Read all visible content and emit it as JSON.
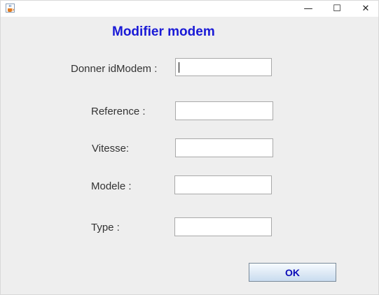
{
  "window": {
    "minimize_glyph": "—",
    "maximize_glyph": "☐",
    "close_glyph": "✕"
  },
  "form": {
    "title": "Modifier modem",
    "title_color": "#1a1ad6",
    "fields": {
      "idmodem": {
        "label": "Donner idModem :",
        "value": ""
      },
      "reference": {
        "label": "Reference :",
        "value": ""
      },
      "vitesse": {
        "label": "Vitesse:",
        "value": ""
      },
      "modele": {
        "label": "Modele :",
        "value": ""
      },
      "type": {
        "label": "Type :",
        "value": ""
      }
    },
    "ok_label": "OK"
  },
  "icons": {
    "app": "java-cup-icon",
    "minimize": "minimize-icon",
    "maximize": "maximize-icon",
    "close": "close-icon"
  }
}
